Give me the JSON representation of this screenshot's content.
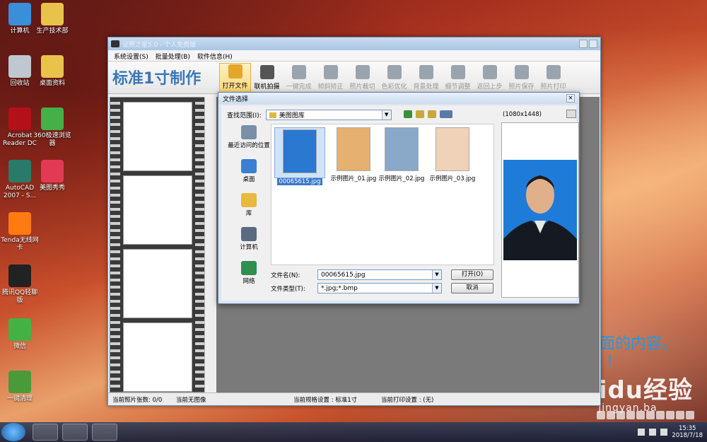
{
  "desktop": {
    "icons": [
      {
        "label": "计算机",
        "color": "#3a8fd8"
      },
      {
        "label": "生产技术部",
        "color": "#e8c24a"
      },
      {
        "label": "回收站",
        "color": "#bfc8d0"
      },
      {
        "label": "桌面资料",
        "color": "#e8c24a"
      },
      {
        "label": "Acrobat Reader DC",
        "color": "#b3101a"
      },
      {
        "label": "360极速浏览器",
        "color": "#44b048"
      },
      {
        "label": "AutoCAD 2007 - S...",
        "color": "#2a7a6a"
      },
      {
        "label": "美图秀秀",
        "color": "#e23a54"
      },
      {
        "label": "Tenda无线网卡",
        "color": "#ff7a10"
      },
      {
        "label": "腾讯QQ轻聊版",
        "color": "#222222"
      },
      {
        "label": "微信",
        "color": "#43b245"
      },
      {
        "label": "一键清理",
        "color": "#4a9a3a"
      }
    ],
    "overlay_text_1": "面的内容。",
    "overlay_text_2": "!",
    "watermark": "Baidu经验",
    "watermark_sub": "jingyan.ba"
  },
  "window": {
    "title": "证照之星5.0 - 个人免费版",
    "menu": [
      "系统设置(S)",
      "批量处理(B)",
      "软件信息(H)"
    ],
    "brand": "标准1寸制作",
    "tools": [
      {
        "label": "打开文件",
        "state": "selected"
      },
      {
        "label": "联机拍摄",
        "state": "active"
      },
      {
        "label": "一键完成",
        "state": "disabled"
      },
      {
        "label": "倾斜矫正",
        "state": "disabled"
      },
      {
        "label": "照片裁切",
        "state": "disabled"
      },
      {
        "label": "色彩优化",
        "state": "disabled"
      },
      {
        "label": "背景处理",
        "state": "disabled"
      },
      {
        "label": "细节调整",
        "state": "disabled"
      },
      {
        "label": "返回上步",
        "state": "disabled"
      },
      {
        "label": "照片保存",
        "state": "disabled"
      },
      {
        "label": "照片打印",
        "state": "disabled"
      }
    ],
    "status": {
      "count": "当前照片张数: 0/0",
      "image": "当前无图像",
      "spec": "当前规格设置 : 标准1寸",
      "print": "当前打印设置 : (无)"
    }
  },
  "dialog": {
    "title": "文件选择",
    "look_in_label": "查找范围(I):",
    "look_in_value": "美图图库",
    "preview_size": "(1080x1448)",
    "places": [
      "最近访问的位置",
      "桌面",
      "库",
      "计算机",
      "网络"
    ],
    "files": [
      {
        "name": "00065615.jpg",
        "selected": true,
        "bg": "#2a78d0"
      },
      {
        "name": "示例图片_01.jpg",
        "selected": false,
        "bg": "#e6b070"
      },
      {
        "name": "示例图片_02.jpg",
        "selected": false,
        "bg": "#8aa8c8"
      },
      {
        "name": "示例图片_03.jpg",
        "selected": false,
        "bg": "#f0d2b8"
      }
    ],
    "filename_label": "文件名(N):",
    "filename_value": "00065615.jpg",
    "filetype_label": "文件类型(T):",
    "filetype_value": "*.jpg;*.bmp",
    "open_button": "打开(O)",
    "cancel_button": "取消"
  },
  "taskbar": {
    "time": "15:35",
    "date": "2018/7/18"
  }
}
